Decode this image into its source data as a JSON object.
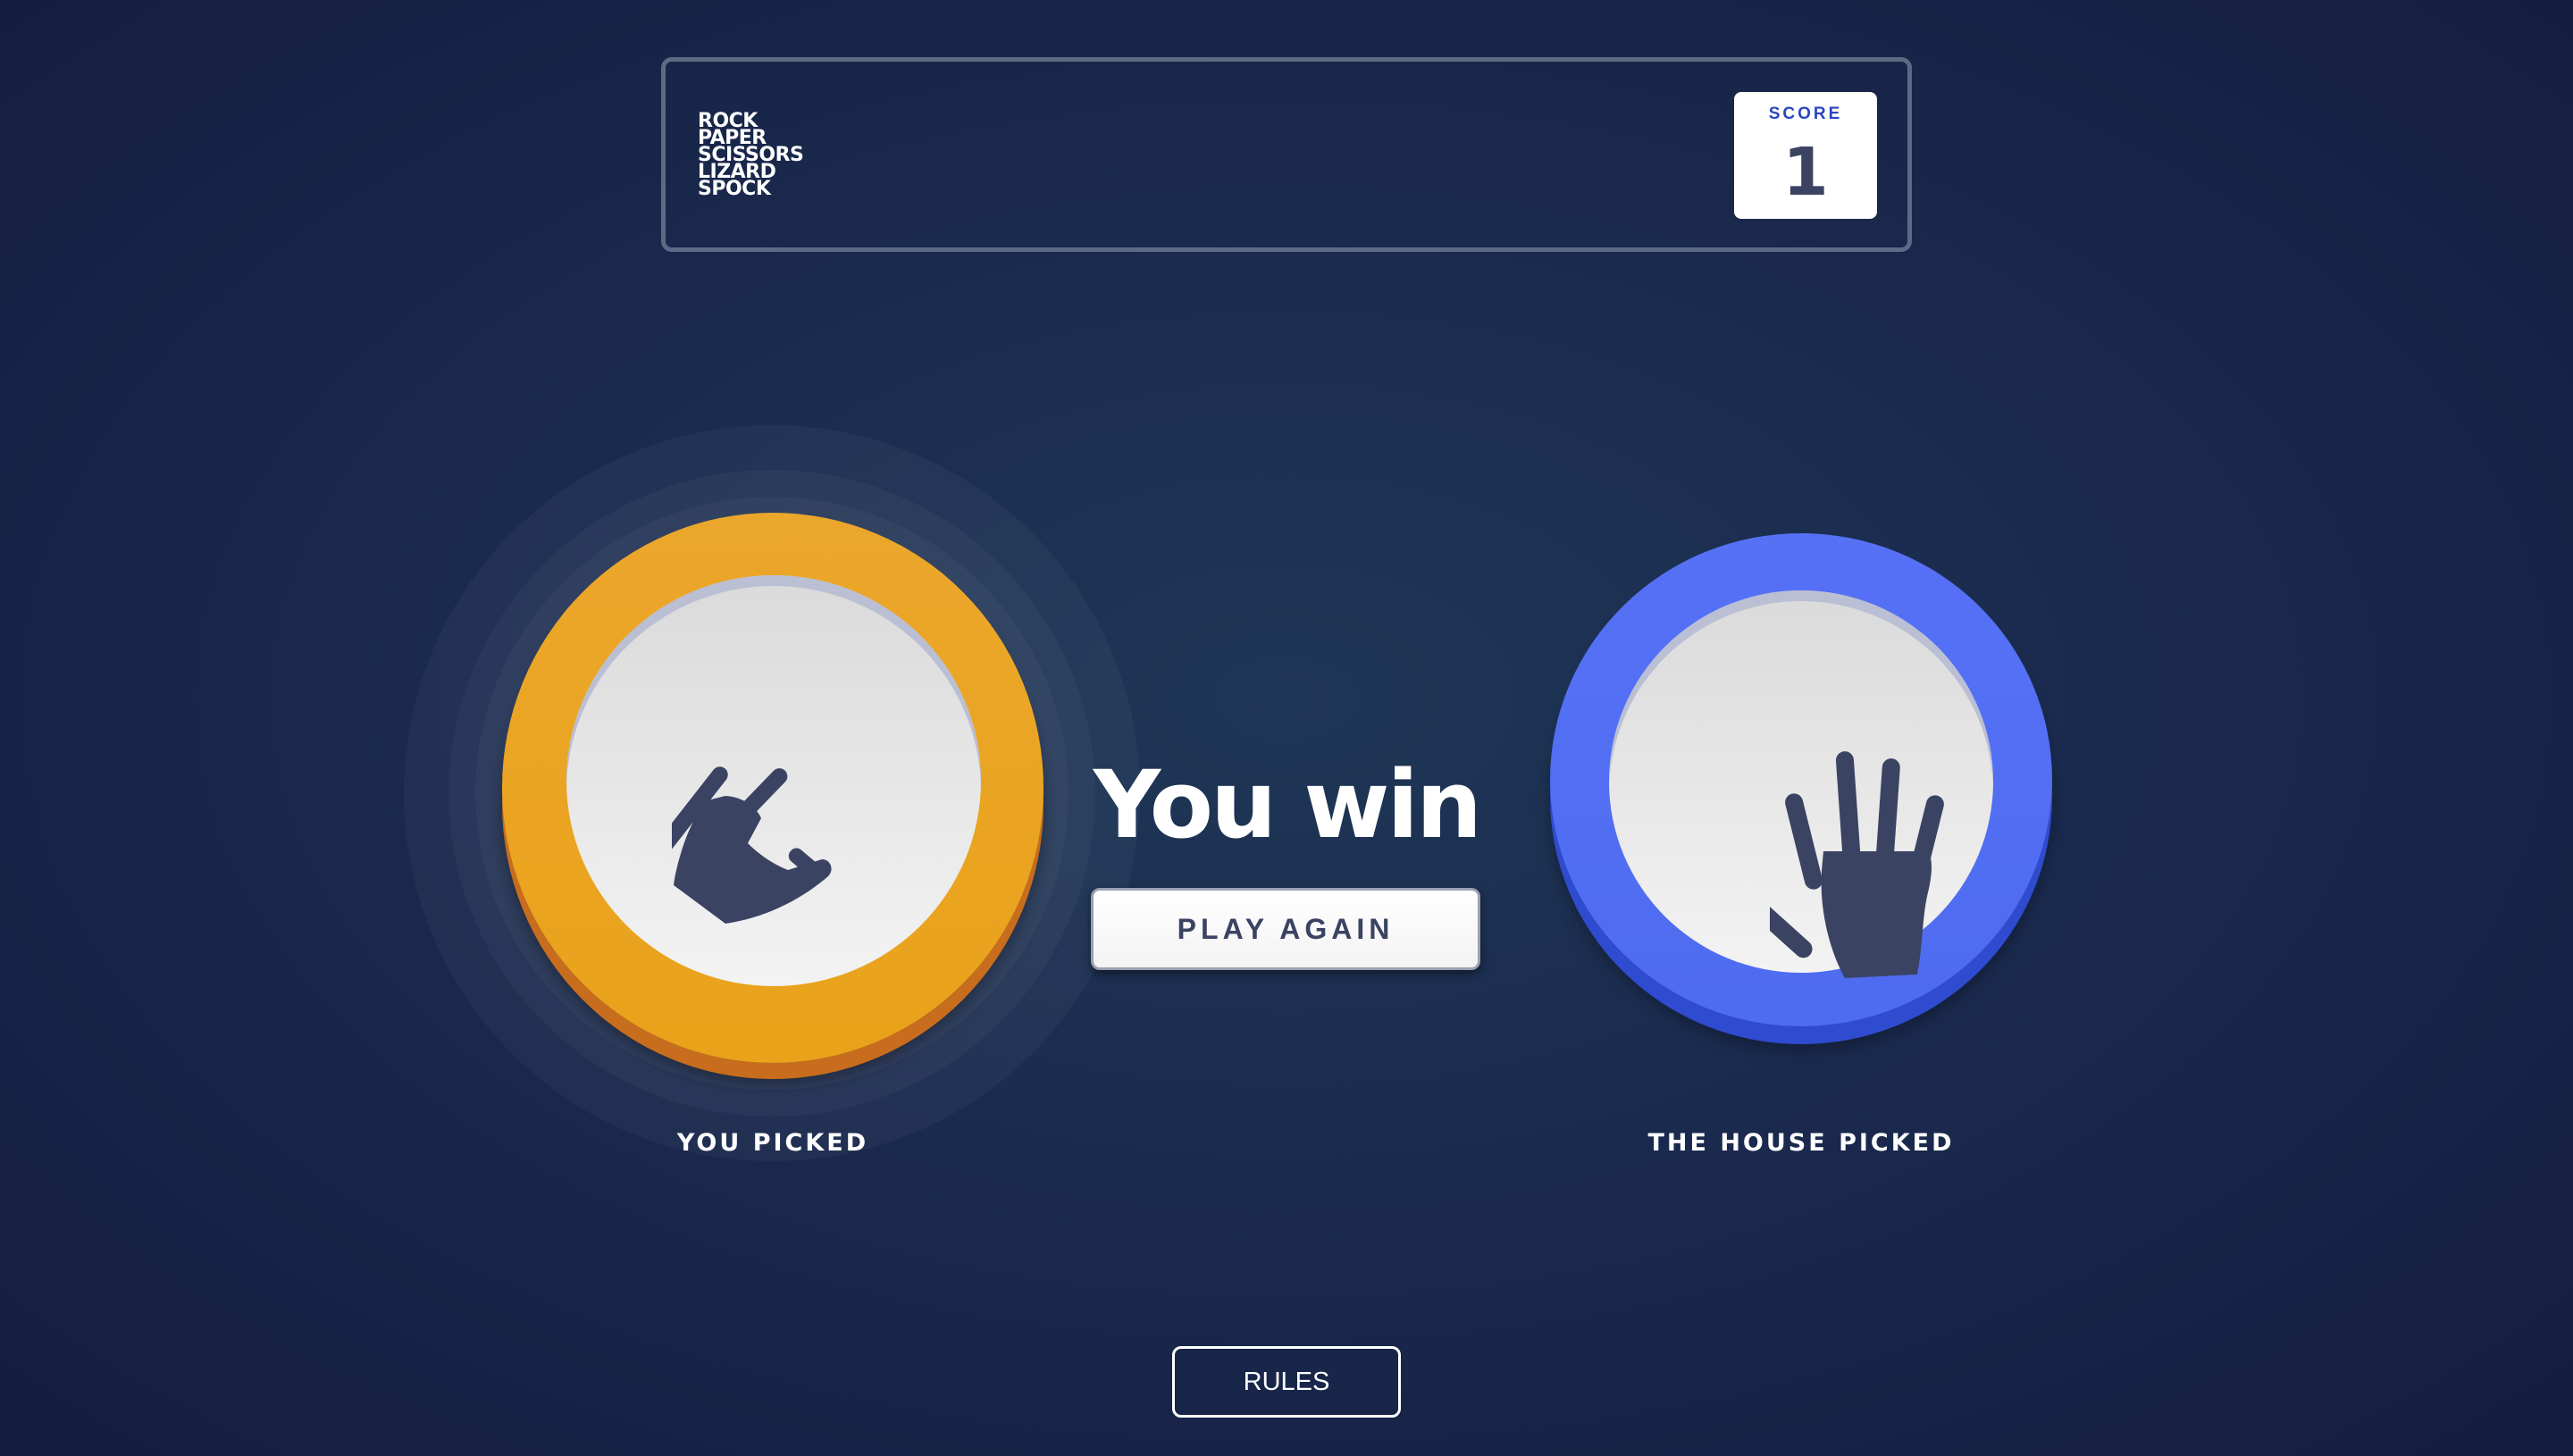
{
  "header": {
    "logo_lines": [
      "ROCK",
      "PAPER",
      "SCISSORS",
      "LIZARD",
      "SPOCK"
    ],
    "score_label": "SCORE",
    "score_value": "1"
  },
  "player": {
    "label": "YOU PICKED",
    "choice_icon": "lizard-icon",
    "ring_color": "#eba72c",
    "winner_highlight": true
  },
  "house": {
    "label": "THE HOUSE PICKED",
    "choice_icon": "paper-icon",
    "ring_color": "#5671f5"
  },
  "result": {
    "text": "You win",
    "play_again_label": "PLAY AGAIN"
  },
  "footer": {
    "rules_label": "RULES"
  }
}
